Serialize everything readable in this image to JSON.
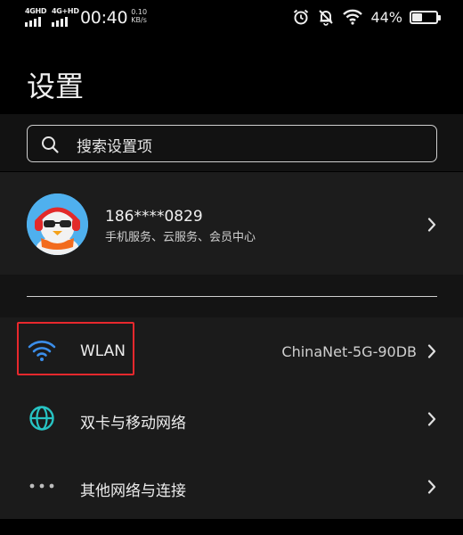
{
  "status_bar": {
    "sim1_tag": "4GHD",
    "sim2_tag": "4G+HD",
    "time": "00:40",
    "net_speed_value": "0.10",
    "net_speed_unit": "KB/s",
    "battery_percent": "44%",
    "battery_level": 0.44,
    "icons": [
      "alarm-icon",
      "mute-bell-icon",
      "wifi-icon",
      "battery-icon"
    ]
  },
  "header": {
    "title": "设置"
  },
  "search": {
    "placeholder": "搜索设置项"
  },
  "account": {
    "phone": "186****0829",
    "services": "手机服务、云服务、会员中心"
  },
  "network_items": [
    {
      "label": "WLAN",
      "value": "ChinaNet-5G-90DB",
      "icon": "wifi-icon",
      "icon_color": "#3b8eea",
      "highlighted": true
    },
    {
      "label": "双卡与移动网络",
      "value": "",
      "icon": "globe-icon",
      "icon_color": "#27c4c4"
    },
    {
      "label": "其他网络与连接",
      "value": "",
      "icon": "more-dots-icon",
      "icon_color": "#bdbdbd"
    }
  ],
  "colors": {
    "background": "#000000",
    "card": "#1c1c1c",
    "highlight_box": "#e8282d",
    "wlan_icon": "#3b8eea",
    "globe_icon": "#27c4c4"
  }
}
